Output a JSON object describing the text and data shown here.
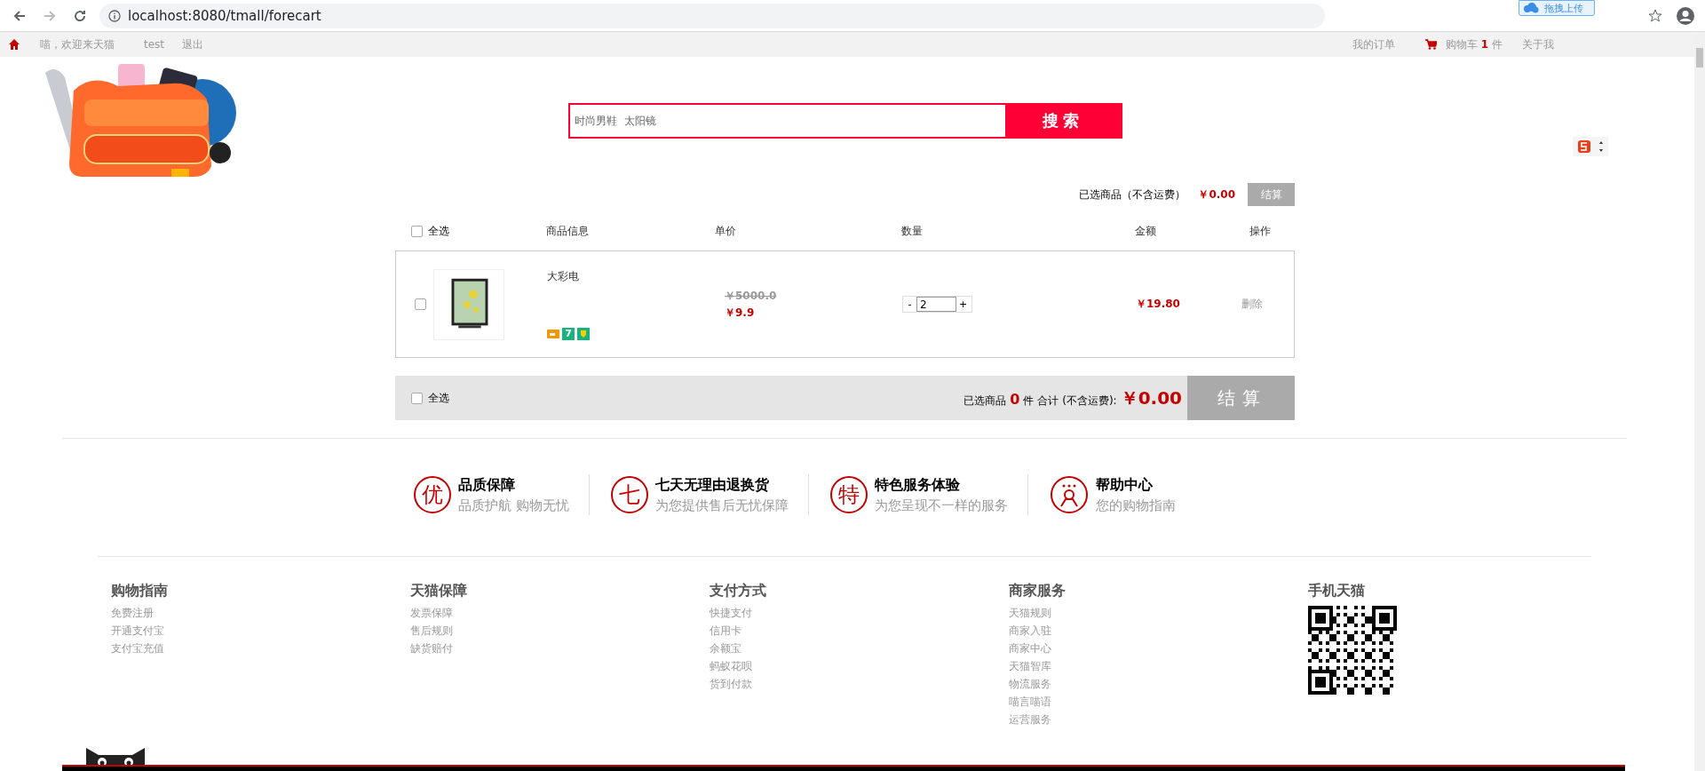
{
  "browser": {
    "url": "localhost:8080/tmall/forecart",
    "upload_widget": "拖拽上传"
  },
  "top_nav": {
    "left": [
      "喵，欢迎来天猫",
      "test",
      "退出"
    ],
    "my_orders": "我的订单",
    "cart_label": "购物车",
    "cart_count": "1",
    "cart_unit": "件",
    "about": "关于我"
  },
  "search": {
    "value": "时尚男鞋  太阳镜",
    "button": "搜索"
  },
  "cart": {
    "summary": {
      "label": "已选商品（不含运费）",
      "amount": "￥0.00",
      "button": "结算"
    },
    "select_all": {
      "label": "全选",
      "checked": false
    },
    "columns": [
      "商品信息",
      "单价",
      "数量",
      "金额",
      "操作"
    ],
    "items": [
      {
        "checked": false,
        "name": "大彩电",
        "badges": [
          {
            "kind": "card"
          },
          {
            "kind": "text",
            "text": "7"
          },
          {
            "kind": "shield"
          }
        ],
        "original_price": "￥5000.0",
        "price": "￥9.9",
        "minus": "-",
        "quantity": "2",
        "plus": "+",
        "subtotal": "￥19.80",
        "action": "删除"
      }
    ],
    "footer_bar": {
      "select_all": {
        "label": "全选",
        "checked": false
      },
      "selected_label": "已选商品",
      "count": "0",
      "unit": "件",
      "total_label": "合计 (不含运费):",
      "total": "￥0.00",
      "button": "结算"
    }
  },
  "services": [
    {
      "kind": "char",
      "icon": "优",
      "title": "品质保障",
      "subtitle": "品质护航 购物无忧"
    },
    {
      "kind": "char",
      "icon": "七",
      "title": "七天无理由退换货",
      "subtitle": "为您提供售后无忧保障"
    },
    {
      "kind": "char",
      "icon": "特",
      "title": "特色服务体验",
      "subtitle": "为您呈现不一样的服务"
    },
    {
      "kind": "person",
      "title": "帮助中心",
      "subtitle": "您的购物指南"
    }
  ],
  "footer": {
    "columns": [
      {
        "title": "购物指南",
        "links": [
          "免费注册",
          "开通支付宝",
          "支付宝充值"
        ]
      },
      {
        "title": "天猫保障",
        "links": [
          "发票保障",
          "售后规则",
          "缺货赔付"
        ]
      },
      {
        "title": "支付方式",
        "links": [
          "快捷支付",
          "信用卡",
          "余额宝",
          "蚂蚁花呗",
          "货到付款"
        ]
      },
      {
        "title": "商家服务",
        "links": [
          "天猫规则",
          "商家入驻",
          "商家中心",
          "天猫智库",
          "物流服务",
          "喵言喵语",
          "运营服务"
        ]
      }
    ],
    "app": {
      "title": "手机天猫"
    }
  }
}
